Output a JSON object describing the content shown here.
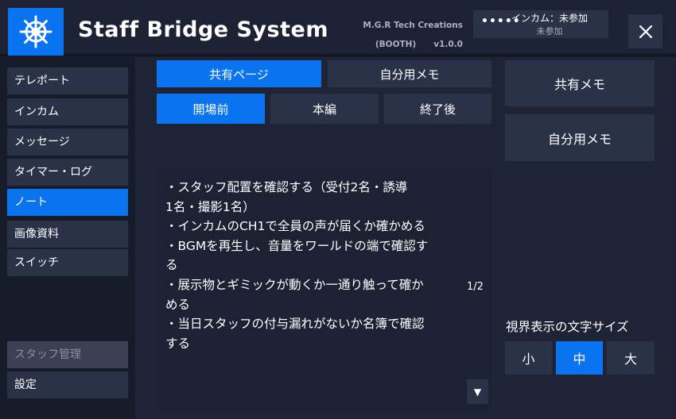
{
  "header": {
    "title": "Staff Bridge System",
    "credit_line1": "M.G.R Tech Creations",
    "credit_line2_left": "(BOOTH)",
    "credit_line2_right": "v1.0.0",
    "intercom_dots": "•••••",
    "intercom_label": "インカム：未参加",
    "intercom_state": "未参加",
    "close_icon": "close-icon",
    "logo_icon": "ship-wheel-icon"
  },
  "sidebar": {
    "items": [
      {
        "label": "テレポート"
      },
      {
        "label": "インカム"
      },
      {
        "label": "メッセージ"
      },
      {
        "label": "タイマー・ログ"
      },
      {
        "label": "ノート",
        "active": true
      },
      {
        "label": "画像資料"
      },
      {
        "label": "スイッチ"
      }
    ],
    "bottom_items": [
      {
        "label": "スタッフ管理",
        "disabled": true
      },
      {
        "label": "設定"
      }
    ]
  },
  "main": {
    "tabs": [
      {
        "label": "共有ページ",
        "active": true
      },
      {
        "label": "自分用メモ"
      }
    ],
    "phases": [
      {
        "label": "開場前",
        "active": true
      },
      {
        "label": "本編"
      },
      {
        "label": "終了後"
      }
    ],
    "note_lines": [
      "・スタッフ配置を確認する（受付2名・誘導",
      "1名・撮影1名）",
      "・インカムのCH1で全員の声が届くか確かめる",
      "・BGMを再生し、音量をワールドの端で確認す",
      "る",
      "・展示物とギミックが動くか一通り触って確か",
      "める",
      "・当日スタッフの付与漏れがないか名簿で確認",
      "する"
    ],
    "page_indicator": "1/2",
    "scroll_down_glyph": "▼"
  },
  "right_panel": {
    "shared_memo": "共有メモ",
    "personal_memo": "自分用メモ",
    "font_size_label": "視界表示の文字サイズ",
    "sizes": [
      {
        "label": "小"
      },
      {
        "label": "中",
        "active": true
      },
      {
        "label": "大"
      }
    ]
  },
  "colors": {
    "accent": "#0a74f0",
    "background": "#161b2a",
    "panel": "#1e2436",
    "button": "#2a3248"
  }
}
